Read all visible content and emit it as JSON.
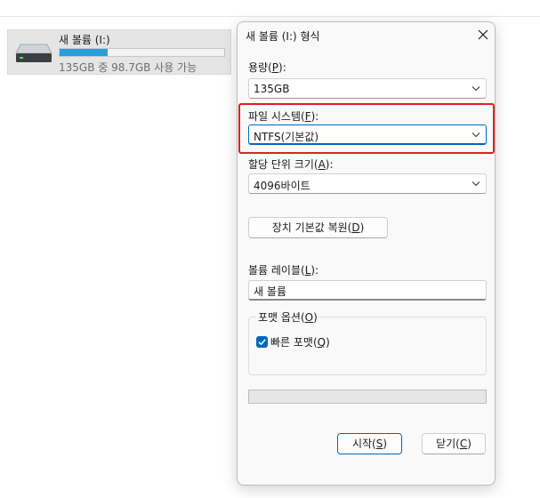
{
  "drive": {
    "name": "새 볼륨 (I:)",
    "space_text": "135GB 중 98.7GB 사용 가능",
    "used_fraction": 0.29,
    "icon": "hard-drive-icon"
  },
  "dialog": {
    "title": "새 볼륨 (I:) 형식",
    "close_icon": "close-icon",
    "capacity": {
      "label": "용량(",
      "mnemonic": "P",
      "label_end": "):",
      "value": "135GB"
    },
    "file_system": {
      "label": "파일 시스템(",
      "mnemonic": "F",
      "label_end": "):",
      "value": "NTFS(기본값)"
    },
    "allocation": {
      "label": "할당 단위 크기(",
      "mnemonic": "A",
      "label_end": "):",
      "value": "4096바이트"
    },
    "restore_button": {
      "label": "장치 기본값 복원(",
      "mnemonic": "D",
      "label_end": ")"
    },
    "volume_label": {
      "label": "볼륨 레이블(",
      "mnemonic": "L",
      "label_end": "):",
      "value": "새 볼륨"
    },
    "format_options": {
      "legend": "포맷 옵션(",
      "mnemonic": "O",
      "legend_end": ")",
      "quick_format": {
        "label": "빠른 포맷(",
        "mnemonic": "Q",
        "label_end": ")",
        "checked": true
      }
    },
    "progress": 0,
    "start_button": {
      "label": "시작(",
      "mnemonic": "S",
      "label_end": ")"
    },
    "close_button": {
      "label": "닫기(",
      "mnemonic": "C",
      "label_end": ")"
    }
  },
  "colors": {
    "accent": "#0067c0",
    "highlight_border": "#e02020",
    "drive_bar": "#26a0da"
  }
}
